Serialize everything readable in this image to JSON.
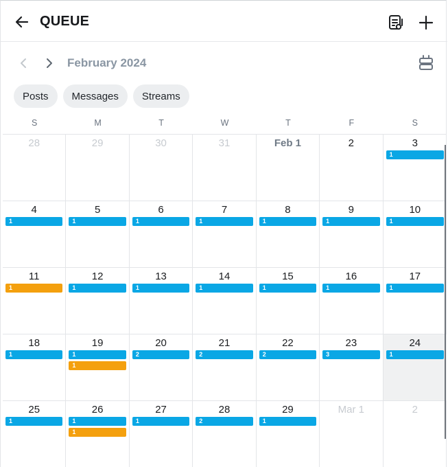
{
  "header": {
    "title": "QUEUE"
  },
  "nav": {
    "month": "February 2024"
  },
  "filters": [
    "Posts",
    "Messages",
    "Streams"
  ],
  "weekdays": [
    "S",
    "M",
    "T",
    "W",
    "T",
    "F",
    "S"
  ],
  "colors": {
    "blue": "#0aa7e5",
    "orange": "#f4a00e",
    "highlight": "#f0f1f2"
  },
  "calendar": [
    {
      "label": "28",
      "muted": true,
      "bars": []
    },
    {
      "label": "29",
      "muted": true,
      "bars": []
    },
    {
      "label": "30",
      "muted": true,
      "bars": []
    },
    {
      "label": "31",
      "muted": true,
      "bars": []
    },
    {
      "label": "Feb 1",
      "feb1": true,
      "bars": []
    },
    {
      "label": "2",
      "bars": []
    },
    {
      "label": "3",
      "bars": [
        {
          "count": "1",
          "color": "blue"
        }
      ]
    },
    {
      "label": "4",
      "bars": [
        {
          "count": "1",
          "color": "blue"
        }
      ]
    },
    {
      "label": "5",
      "bars": [
        {
          "count": "1",
          "color": "blue"
        }
      ]
    },
    {
      "label": "6",
      "bars": [
        {
          "count": "1",
          "color": "blue"
        }
      ]
    },
    {
      "label": "7",
      "bars": [
        {
          "count": "1",
          "color": "blue"
        }
      ]
    },
    {
      "label": "8",
      "bars": [
        {
          "count": "1",
          "color": "blue"
        }
      ]
    },
    {
      "label": "9",
      "bars": [
        {
          "count": "1",
          "color": "blue"
        }
      ]
    },
    {
      "label": "10",
      "bars": [
        {
          "count": "1",
          "color": "blue"
        }
      ]
    },
    {
      "label": "11",
      "bars": [
        {
          "count": "1",
          "color": "orange"
        }
      ]
    },
    {
      "label": "12",
      "bars": [
        {
          "count": "1",
          "color": "blue"
        }
      ]
    },
    {
      "label": "13",
      "bars": [
        {
          "count": "1",
          "color": "blue"
        }
      ]
    },
    {
      "label": "14",
      "bars": [
        {
          "count": "1",
          "color": "blue"
        }
      ]
    },
    {
      "label": "15",
      "bars": [
        {
          "count": "1",
          "color": "blue"
        }
      ]
    },
    {
      "label": "16",
      "bars": [
        {
          "count": "1",
          "color": "blue"
        }
      ]
    },
    {
      "label": "17",
      "bars": [
        {
          "count": "1",
          "color": "blue"
        }
      ]
    },
    {
      "label": "18",
      "bars": [
        {
          "count": "1",
          "color": "blue"
        }
      ]
    },
    {
      "label": "19",
      "bars": [
        {
          "count": "1",
          "color": "blue"
        },
        {
          "count": "1",
          "color": "orange"
        }
      ]
    },
    {
      "label": "20",
      "bars": [
        {
          "count": "2",
          "color": "blue"
        }
      ]
    },
    {
      "label": "21",
      "bars": [
        {
          "count": "2",
          "color": "blue"
        }
      ]
    },
    {
      "label": "22",
      "bars": [
        {
          "count": "2",
          "color": "blue"
        }
      ]
    },
    {
      "label": "23",
      "bars": [
        {
          "count": "3",
          "color": "blue"
        }
      ]
    },
    {
      "label": "24",
      "highlight": true,
      "bars": [
        {
          "count": "1",
          "color": "blue"
        }
      ]
    },
    {
      "label": "25",
      "bars": [
        {
          "count": "1",
          "color": "blue"
        }
      ]
    },
    {
      "label": "26",
      "bars": [
        {
          "count": "1",
          "color": "blue"
        },
        {
          "count": "1",
          "color": "orange"
        }
      ]
    },
    {
      "label": "27",
      "bars": [
        {
          "count": "1",
          "color": "blue"
        }
      ]
    },
    {
      "label": "28",
      "bars": [
        {
          "count": "2",
          "color": "blue"
        }
      ]
    },
    {
      "label": "29",
      "bars": [
        {
          "count": "1",
          "color": "blue"
        }
      ]
    },
    {
      "label": "Mar 1",
      "muted": true,
      "bars": []
    },
    {
      "label": "2",
      "muted": true,
      "bars": []
    }
  ]
}
